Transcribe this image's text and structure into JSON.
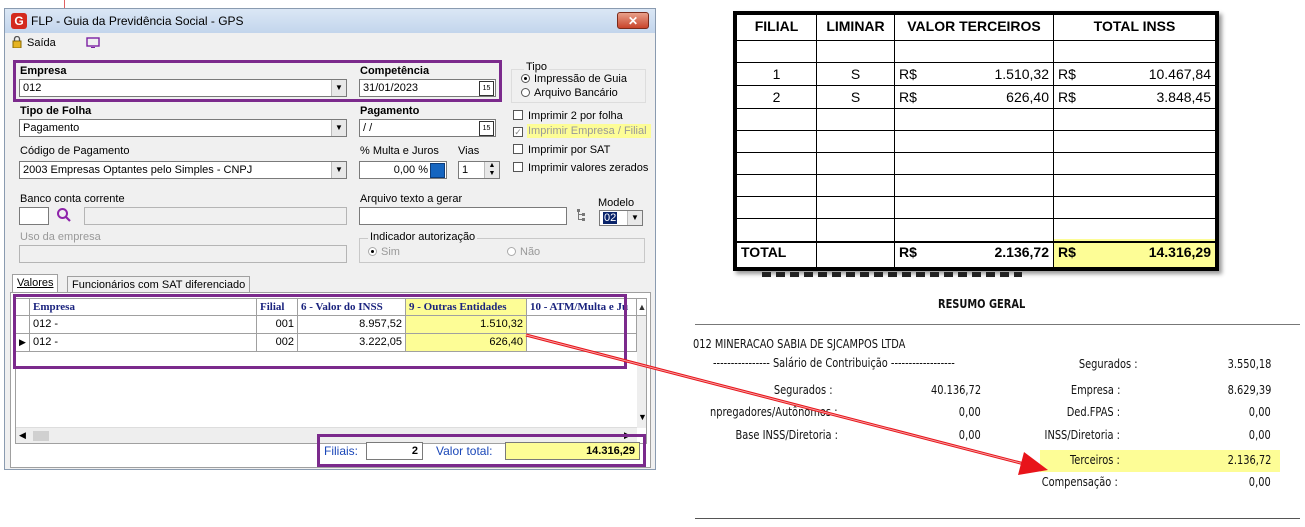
{
  "window": {
    "title": "FLP - Guia da Previdência Social - GPS",
    "close": "✕",
    "menu_exit": "Saída"
  },
  "form": {
    "empresa_label": "Empresa",
    "empresa_value": "012",
    "competencia_label": "Competência",
    "competencia_value": "31/01/2023",
    "tipo_label": "Tipo",
    "tipo_options": [
      "Impressão de Guia",
      "Arquivo Bancário"
    ],
    "tipo_folha_label": "Tipo de Folha",
    "tipo_folha_value": "Pagamento",
    "pagamento_label": "Pagamento",
    "pagamento_value": " /  /",
    "codigo_label": "Código de Pagamento",
    "codigo_value": "2003  Empresas Optantes pelo Simples - CNPJ",
    "multa_label": "% Multa e Juros",
    "multa_value": "0,00 %",
    "vias_label": "Vias",
    "vias_value": "1",
    "check_imprimir2": "Imprimir 2 por folha",
    "check_imprimir_empresa": "Imprimir Empresa / Filial",
    "check_imprimir_sat": "Imprimir por SAT",
    "check_imprimir_zerados": "Imprimir valores zerados",
    "banco_label": "Banco conta corrente",
    "arquivo_label": "Arquivo texto a gerar",
    "modelo_label": "Modelo",
    "modelo_value": "02",
    "uso_label": "Uso da empresa",
    "indicador_label": "Indicador autorização",
    "indicador_sim": "Sim",
    "indicador_nao": "Não"
  },
  "tabs": [
    "Valores",
    "Funcionários com SAT diferenciado"
  ],
  "grid": {
    "headers": [
      "Empresa",
      "Filial",
      "6 - Valor do INSS",
      "9 - Outras Entidades",
      "10 - ATM/Multa e Ju"
    ],
    "rows": [
      {
        "empresa": "012 -",
        "filial": "001",
        "inss": "8.957,52",
        "outras": "1.510,32"
      },
      {
        "empresa": "012 -",
        "filial": "002",
        "inss": "3.222,05",
        "outras": "626,40"
      }
    ]
  },
  "footer": {
    "filiais_label": "Filiais:",
    "filiais_value": "2",
    "valor_total_label": "Valor total:",
    "valor_total_value": "14.316,29"
  },
  "table": {
    "headers": [
      "FILIAL",
      "LIMINAR",
      "VALOR TERCEIROS",
      "TOTAL INSS"
    ],
    "rows": [
      {
        "filial": "1",
        "liminar": "S",
        "cur1": "R$",
        "terceiros": "1.510,32",
        "cur2": "R$",
        "inss": "10.467,84"
      },
      {
        "filial": "2",
        "liminar": "S",
        "cur1": "R$",
        "terceiros": "626,40",
        "cur2": "R$",
        "inss": "3.848,45"
      }
    ],
    "total_label": "TOTAL",
    "total_cur1": "R$",
    "total_terceiros": "2.136,72",
    "total_cur2": "R$",
    "total_inss": "14.316,29"
  },
  "summary": {
    "title": "RESUMO GERAL",
    "company": "012 MINERACAO SABIA DE SJCAMPOS LTDA",
    "section": "---------------- Salário de Contribuição ------------------",
    "left_labels": [
      "Segurados :",
      "npregadores/Autônomos :",
      "Base INSS/Diretoria :"
    ],
    "left_values": [
      "40.136,72",
      "0,00",
      "0,00"
    ],
    "right_labels": [
      "Segurados :",
      "Empresa :",
      "Ded.FPAS :",
      "INSS/Diretoria :",
      "Terceiros :",
      "Compensação :"
    ],
    "right_values": [
      "3.550,18",
      "8.629,39",
      "0,00",
      "0,00",
      "2.136,72",
      "0,00"
    ]
  },
  "colors": {
    "highlight": "#fdfd96",
    "annotation": "#7b2a8c",
    "arrow": "#e8141a"
  }
}
